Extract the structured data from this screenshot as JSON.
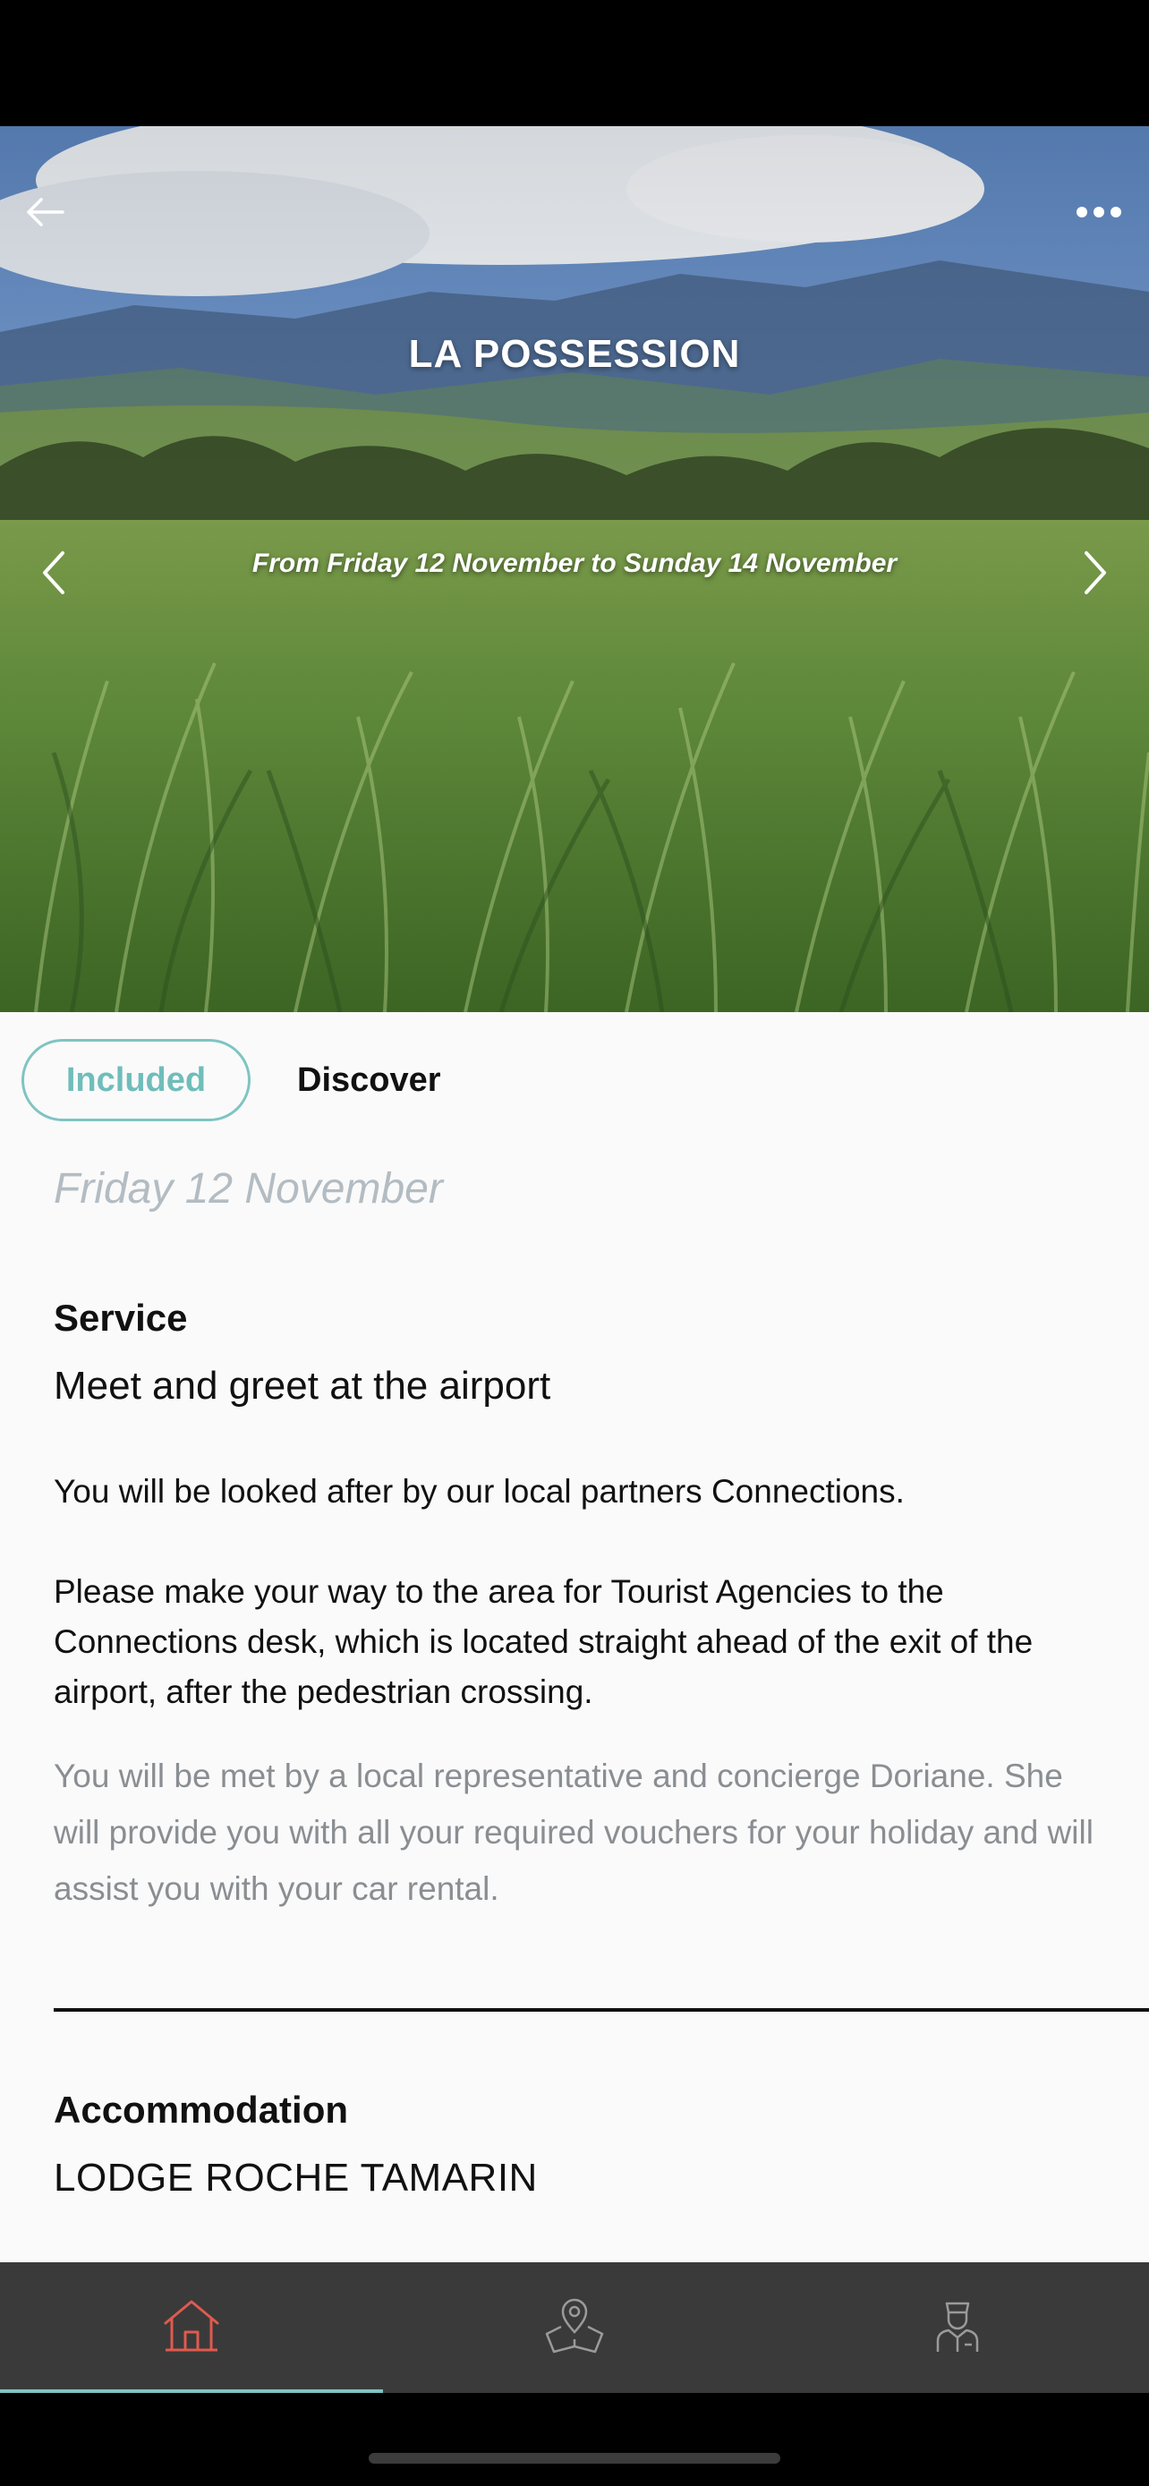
{
  "hero": {
    "title": "LA POSSESSION",
    "dates": "From Friday 12 November to Sunday 14 November",
    "icons": {
      "back": "arrow-left-icon",
      "more": "more-horizontal-icon",
      "prev": "chevron-left-icon",
      "next": "chevron-right-icon"
    }
  },
  "tabs": {
    "included": "Included",
    "discover": "Discover",
    "active": "included"
  },
  "day": {
    "heading": "Friday 12 November"
  },
  "service": {
    "label": "Service",
    "title": "Meet and greet at the airport",
    "para1": "You will be looked after by our local partners Connections.",
    "para2": "Please make your way to the area for Tourist Agencies to the Connections desk, which is located straight ahead of the exit of the airport, after the pedestrian crossing.",
    "para3": "You will be met by a local representative and concierge Doriane. She will provide you with all your required vouchers for your holiday and will assist you with your car rental."
  },
  "accommodation": {
    "label": "Accommodation",
    "name": "LODGE ROCHE TAMARIN"
  },
  "nav": {
    "items": [
      {
        "icon": "home-icon",
        "active": true
      },
      {
        "icon": "map-pin-icon",
        "active": false
      },
      {
        "icon": "concierge-icon",
        "active": false
      }
    ]
  },
  "colors": {
    "accent": "#7fc4c2",
    "active_nav": "#e05a4e",
    "nav_bg": "#3a3a3a",
    "muted_text": "#8a8e92"
  }
}
